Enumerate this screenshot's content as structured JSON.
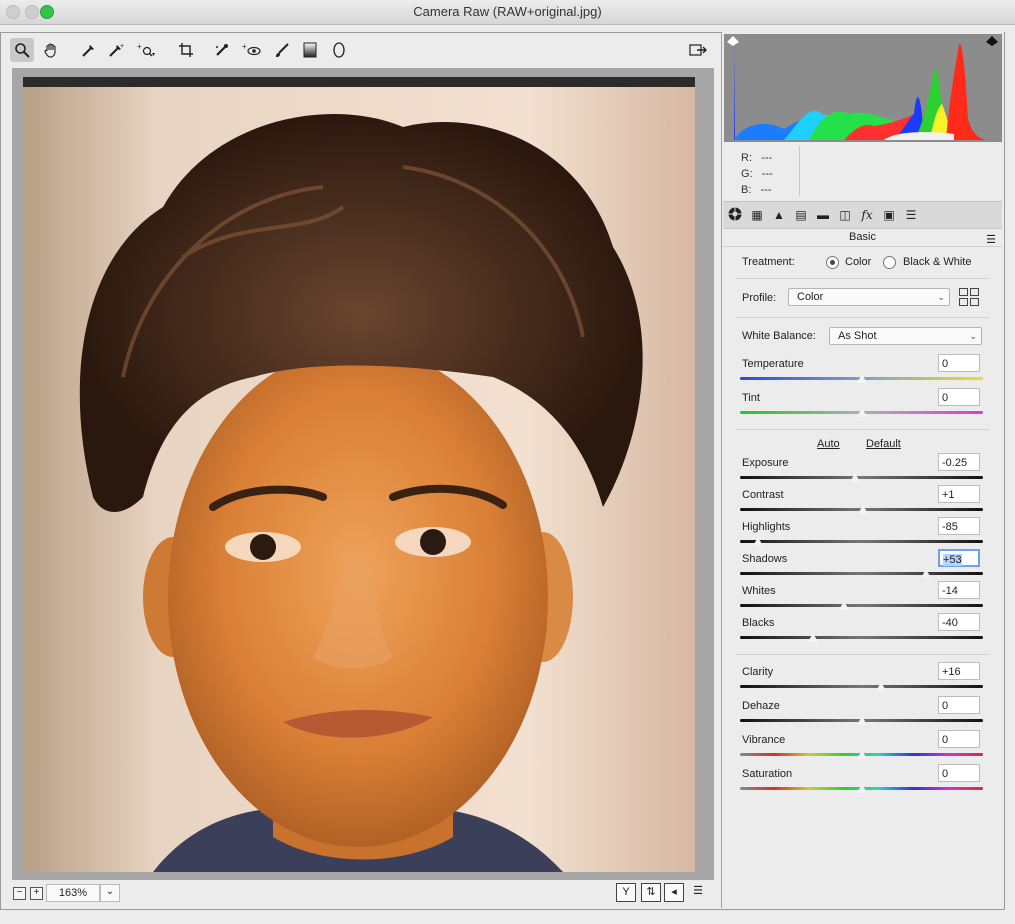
{
  "window": {
    "title": "Camera Raw (RAW+original.jpg)"
  },
  "toolbar": {
    "tools": [
      "zoom-icon",
      "hand-icon",
      "white-balance-icon",
      "color-sampler-icon",
      "targeted-adjustment-icon",
      "crop-icon",
      "spot-removal-icon",
      "red-eye-icon",
      "adjustment-brush-icon",
      "graduated-filter-icon",
      "radial-filter-icon"
    ],
    "active": "zoom-icon"
  },
  "readout": {
    "r_label": "R:",
    "r": "---",
    "g_label": "G:",
    "g": "---",
    "b_label": "B:",
    "b": "---"
  },
  "panel": {
    "section": "Basic",
    "treatment_label": "Treatment:",
    "treatment_options": [
      "Color",
      "Black & White"
    ],
    "treatment_selected": "Color",
    "profile_label": "Profile:",
    "profile_value": "Color",
    "wb_label": "White Balance:",
    "wb_value": "As Shot",
    "auto_label": "Auto",
    "default_label": "Default"
  },
  "sliders": [
    {
      "label": "Temperature",
      "value": "0",
      "level": 0.5,
      "track": "temp"
    },
    {
      "label": "Tint",
      "value": "0",
      "level": 0.5,
      "track": "tint"
    },
    {
      "label": "Exposure",
      "value": "-0.25",
      "level": 0.475,
      "track": "gray"
    },
    {
      "label": "Contrast",
      "value": "+1",
      "level": 0.505,
      "track": "gray"
    },
    {
      "label": "Highlights",
      "value": "-85",
      "level": 0.075,
      "track": "gray"
    },
    {
      "label": "Shadows",
      "value": "+53",
      "level": 0.765,
      "track": "gray",
      "focused": true
    },
    {
      "label": "Whites",
      "value": "-14",
      "level": 0.43,
      "track": "gray"
    },
    {
      "label": "Blacks",
      "value": "-40",
      "level": 0.3,
      "track": "gray"
    },
    {
      "label": "Clarity",
      "value": "+16",
      "level": 0.58,
      "track": "gray"
    },
    {
      "label": "Dehaze",
      "value": "0",
      "level": 0.5,
      "track": "gray"
    },
    {
      "label": "Vibrance",
      "value": "0",
      "level": 0.5,
      "track": "spectrum"
    },
    {
      "label": "Saturation",
      "value": "0",
      "level": 0.5,
      "track": "spectrum"
    }
  ],
  "bottom": {
    "zoom": "163%",
    "minus": "−",
    "plus": "+"
  },
  "colors": {
    "accent": "#6aa3e8",
    "panel_bg": "#ececec",
    "histogram_bg": "#8c8c8c"
  }
}
